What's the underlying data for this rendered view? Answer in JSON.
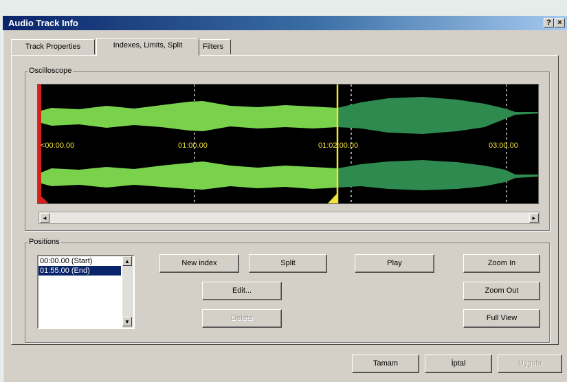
{
  "window": {
    "title": "Audio Track Info",
    "help_label": "?",
    "close_label": "×"
  },
  "tabs": [
    {
      "label": "Track Properties",
      "active": false
    },
    {
      "label": "Indexes, Limits, Split",
      "active": true
    },
    {
      "label": "Filters",
      "active": false
    }
  ],
  "oscilloscope": {
    "label": "Oscilloscope",
    "time_labels": [
      "<00:00.00",
      "01:00.00",
      "01:02:00.00",
      "03:00.00"
    ],
    "colors": {
      "background": "#000000",
      "played": "#7ad24c",
      "unplayed": "#2e8a4e",
      "cursor": "#f2e23a",
      "start_marker": "#d6201c"
    }
  },
  "scroll": {
    "left_arrow": "◄",
    "right_arrow": "►"
  },
  "positions": {
    "label": "Positions",
    "items": [
      {
        "text": "00:00.00 (Start)",
        "selected": false
      },
      {
        "text": "01:55.00 (End)",
        "selected": true
      }
    ],
    "scroll_up": "▲",
    "scroll_down": "▼"
  },
  "buttons": {
    "new_index": "New index",
    "split": "Split",
    "play": "Play",
    "zoom_in": "Zoom In",
    "edit": "Edit...",
    "zoom_out": "Zoom Out",
    "delete": "Delete",
    "full_view": "Full View"
  },
  "footer": {
    "ok": "Tamam",
    "cancel": "İptal",
    "apply": "Uygula"
  }
}
